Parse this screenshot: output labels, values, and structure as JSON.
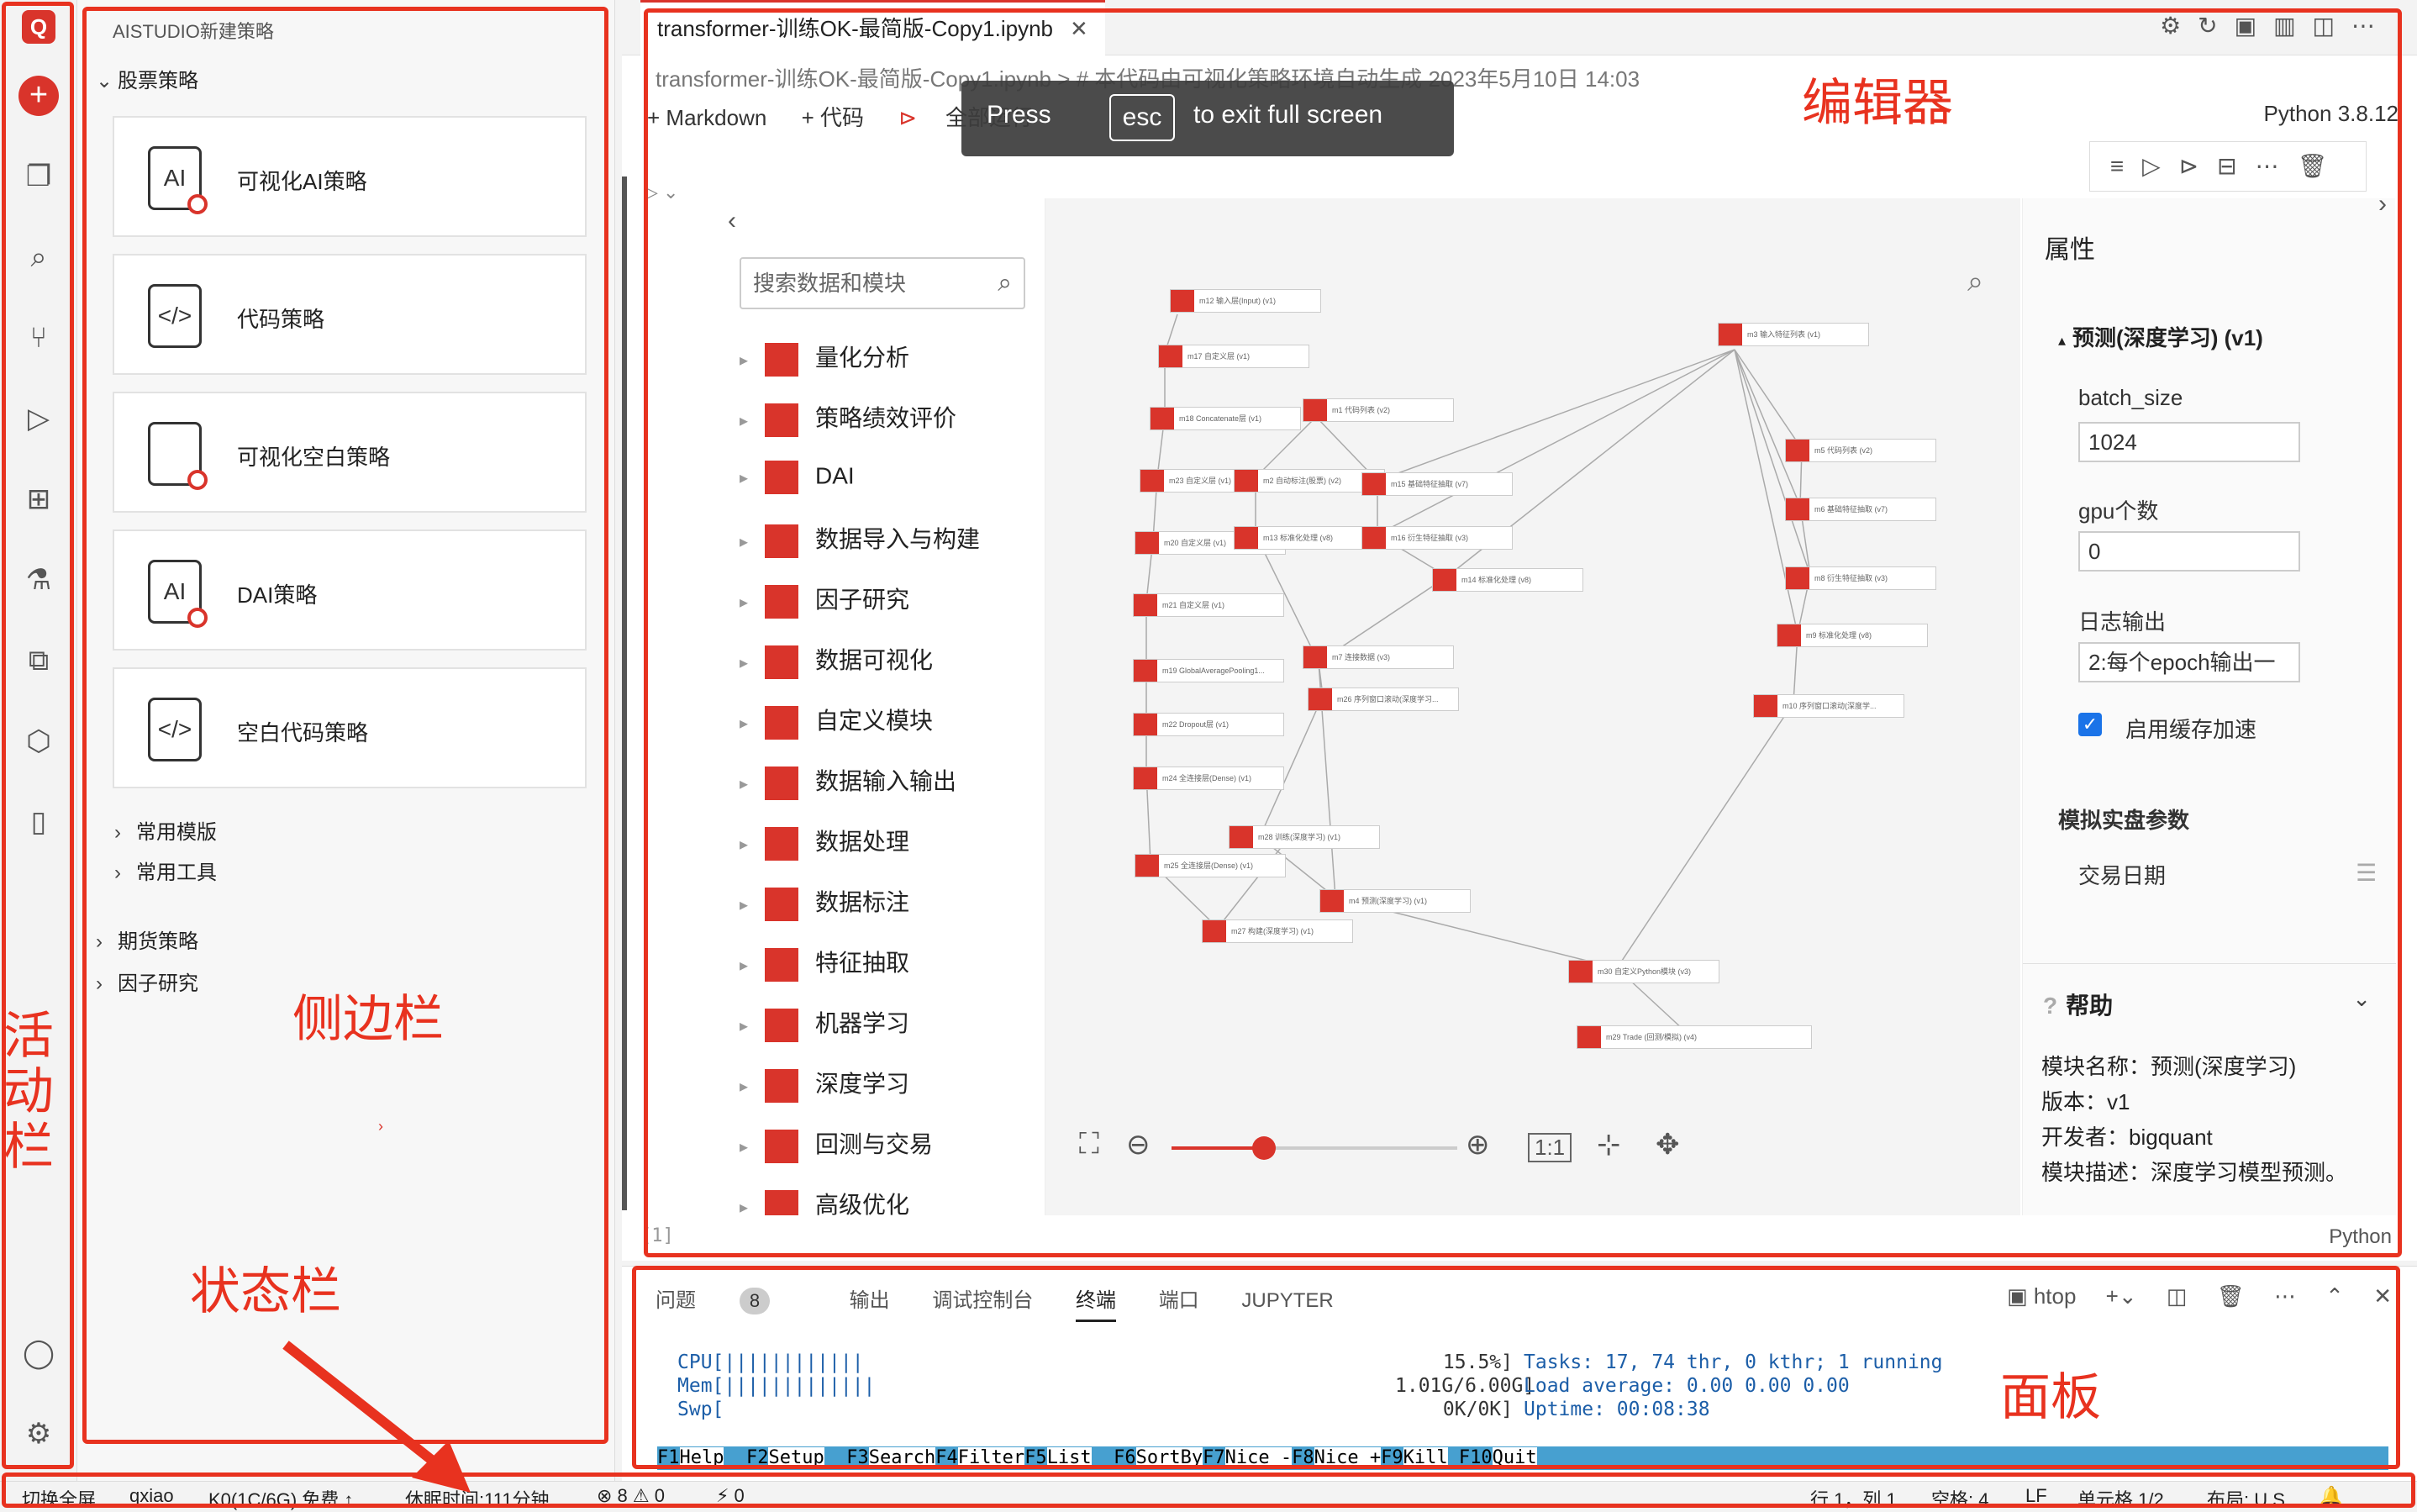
{
  "activity_bar": {
    "logo": "Q",
    "add": "+",
    "icons": [
      "explorer-icon",
      "search-icon",
      "source-control-icon",
      "run-debug-icon",
      "extensions-icon",
      "flask-icon",
      "hierarchy-icon",
      "packages-icon",
      "notebook-icon"
    ],
    "account": "account-icon",
    "settings": "gear-icon"
  },
  "sidebar": {
    "title": "AISTUDIO新建策略",
    "stock_section": "股票策略",
    "cards": [
      {
        "label": "可视化AI策略",
        "icon": "AI"
      },
      {
        "label": "代码策略",
        "icon": "</>"
      },
      {
        "label": "可视化空白策略",
        "icon": ""
      },
      {
        "label": "DAI策略",
        "icon": "AI"
      },
      {
        "label": "空白代码策略",
        "icon": "</>"
      }
    ],
    "sub_sections": [
      "常用模版",
      "常用工具"
    ],
    "sections": [
      "期货策略",
      "因子研究"
    ],
    "tiny_mark": "›"
  },
  "annotations": {
    "activity_bar": "活动栏",
    "sidebar": "侧边栏",
    "statusbar": "状态栏",
    "editor": "编辑器",
    "panel": "面板",
    "color": "#e8321f"
  },
  "editor": {
    "tab_title": "transformer-训练OK-最简版-Copy1.ipynb",
    "breadcrumb": "transformer-训练OK-最简版-Copy1.ipynb > # 本代码由可视化策略环境自动生成 2023年5月10日 14:03",
    "toolbar": {
      "markdown": "+ Markdown",
      "code": "+ 代码",
      "run_all": "全部运行"
    },
    "kernel": "Python 3.8.12",
    "fullscreen_toast": {
      "press": "Press",
      "key": "esc",
      "rest": "to exit full screen"
    },
    "exec_count": "[1]",
    "cell_language": "Python"
  },
  "module_list": {
    "search_placeholder": "搜索数据和模块",
    "items": [
      "量化分析",
      "策略绩效评价",
      "DAI",
      "数据导入与构建",
      "因子研究",
      "数据可视化",
      "自定义模块",
      "数据输入输出",
      "数据处理",
      "数据标注",
      "特征抽取",
      "机器学习",
      "深度学习",
      "回测与交易",
      "高级优化"
    ]
  },
  "graph": {
    "nodes": [
      "m12 输入层(Input) (v1)",
      "m17 自定义层 (v1)",
      "m18 Concatenate层 (v1)",
      "m23 自定义层 (v1)",
      "m20 自定义层 (v1)",
      "m21 自定义层 (v1)",
      "m19 GlobalAveragePooling1...",
      "m22 Dropout层 (v1)",
      "m24 全连接层(Dense) (v1)",
      "m25 全连接层(Dense) (v1)",
      "m27 构建(深度学习) (v1)",
      "m1 代码列表 (v2)",
      "m2 自动标注(股票) (v2)",
      "m13 标准化处理 (v8)",
      "m15 基础特征抽取 (v7)",
      "m16 衍生特征抽取 (v3)",
      "m14 标准化处理 (v8)",
      "m7 连接数据 (v3)",
      "m26 序列窗口滚动(深度学习...",
      "m28 训练(深度学习) (v1)",
      "m4 预测(深度学习) (v1)",
      "m3 输入特征列表 (v1)",
      "m5 代码列表 (v2)",
      "m6 基础特征抽取 (v7)",
      "m8 衍生特征抽取 (v3)",
      "m9 标准化处理 (v8)",
      "m10 序列窗口滚动(深度学...",
      "m30 自定义Python模块 (v3)",
      "m29 Trade (回测/模拟) (v4)"
    ],
    "zoom_reset_label": "1:1",
    "zoom_level": 0.3
  },
  "properties": {
    "title": "属性",
    "module": "预测(深度学习) (v1)",
    "batch_size_label": "batch_size",
    "batch_size_value": "1024",
    "gpu_label": "gpu个数",
    "gpu_value": "0",
    "log_label": "日志输出",
    "log_value": "2:每个epoch输出一",
    "cache_label": "启用缓存加速",
    "cache_checked": true,
    "sim_params": "模拟实盘参数",
    "trade_date": "交易日期",
    "help_title": "帮助",
    "help_lines": [
      "模块名称：预测(深度学习)",
      "版本：v1",
      "开发者：bigquant",
      "模块描述：深度学习模型预测。"
    ]
  },
  "panel": {
    "tabs": [
      "问题",
      "输出",
      "调试控制台",
      "终端",
      "端口",
      "JUPYTER"
    ],
    "problems_count": "8",
    "active_tab": "终端",
    "terminal_name": "htop",
    "htop": {
      "cpu": "CPU[||||||||||||",
      "mem": "Mem[|||||||||||||",
      "swp": "Swp[",
      "cpu_val": "15.5%]",
      "mem_val": "1.01G/6.00G]",
      "swp_val": "0K/0K]",
      "tasks": "Tasks: 17, 74 thr, 0 kthr; 1 running",
      "load": "Load average: 0.00 0.00 0.00",
      "uptime": "Uptime: 00:08:38"
    },
    "fkeys": [
      "F1",
      "Help",
      "F2",
      "Setup",
      "F3",
      "Search",
      "F4",
      "Filter",
      "F5",
      "List",
      "F6",
      "SortBy",
      "F7",
      "Nice -",
      "F8",
      "Nice +",
      "F9",
      "Kill",
      "F10",
      "Quit"
    ]
  },
  "statusbar": {
    "fullscreen": "切换全屏",
    "user": "qxiao",
    "resource": "K0(1C/6G) 免费 ↑",
    "sleep": "休眠时间:111分钟",
    "errors": "⊗ 8 ⚠ 0",
    "ports": "⚡ 0",
    "position": "行 1，列 1",
    "spaces": "空格: 4",
    "eol": "LF",
    "cell": "单元格 1/2",
    "layout": "布局: U.S.",
    "bell": "🔔"
  }
}
